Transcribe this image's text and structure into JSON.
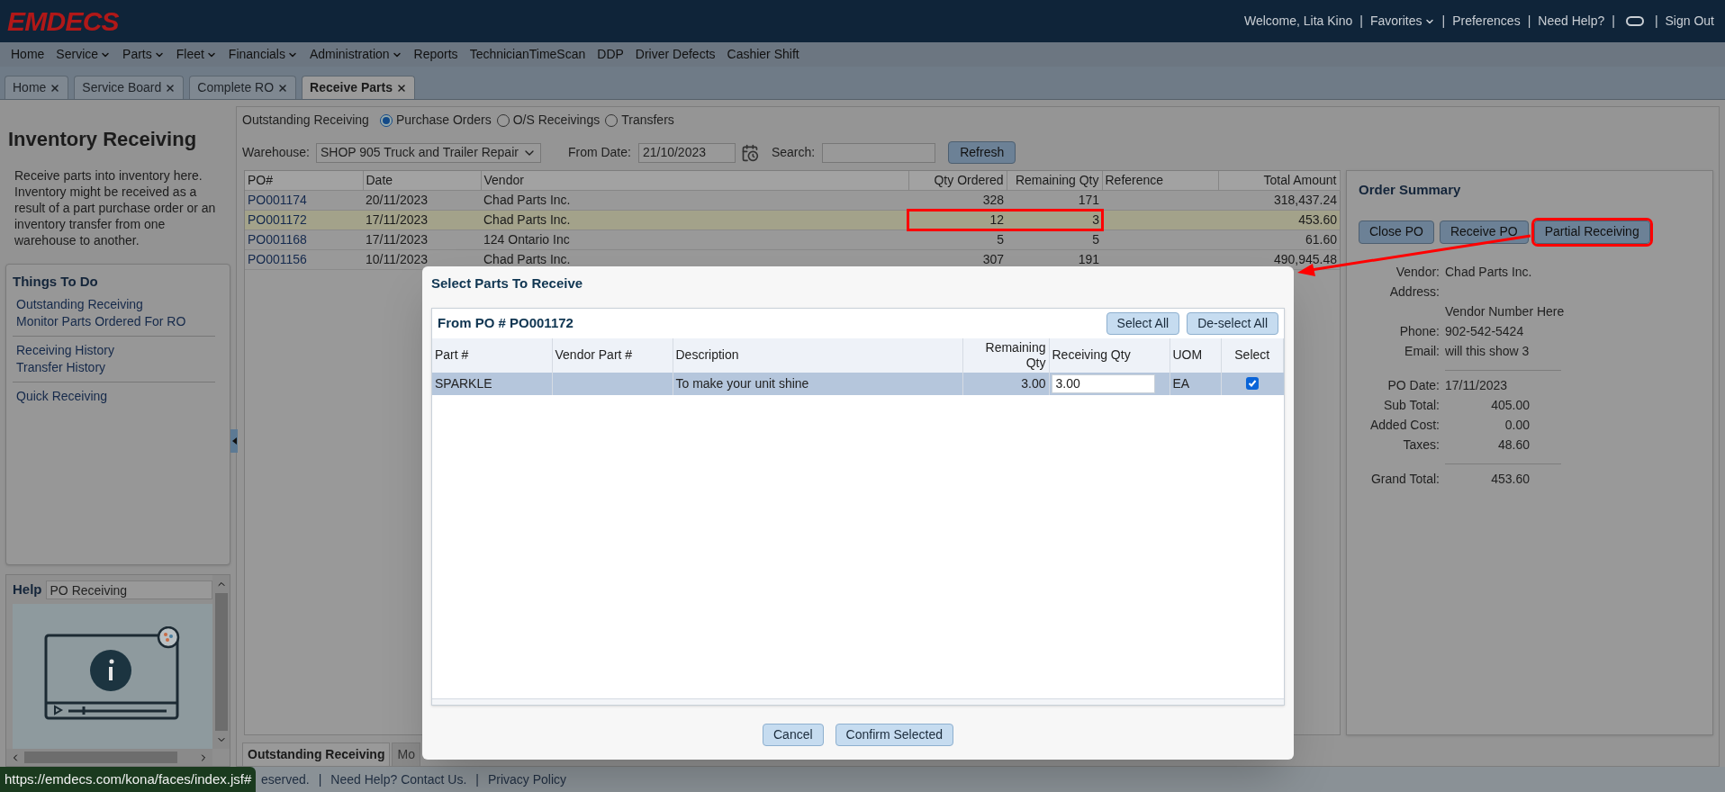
{
  "header": {
    "logo": "EMDECS",
    "items": [
      {
        "kind": "text",
        "label": "Welcome, Lita Kino"
      },
      {
        "kind": "separator",
        "label": "|"
      },
      {
        "kind": "menu",
        "label": "Favorites"
      },
      {
        "kind": "separator",
        "label": "|"
      },
      {
        "kind": "link",
        "label": "Preferences"
      },
      {
        "kind": "separator",
        "label": "|"
      },
      {
        "kind": "link",
        "label": "Need Help?"
      },
      {
        "kind": "separator",
        "label": "|"
      },
      {
        "kind": "toggle"
      },
      {
        "kind": "separator",
        "label": "|"
      },
      {
        "kind": "link",
        "label": "Sign Out"
      }
    ]
  },
  "menu": [
    {
      "label": "Home",
      "dropdown": false
    },
    {
      "label": "Service",
      "dropdown": true
    },
    {
      "label": "Parts",
      "dropdown": true
    },
    {
      "label": "Fleet",
      "dropdown": true
    },
    {
      "label": "Financials",
      "dropdown": true
    },
    {
      "label": "Administration",
      "dropdown": true
    },
    {
      "label": "Reports",
      "dropdown": false
    },
    {
      "label": "TechnicianTimeScan",
      "dropdown": false
    },
    {
      "label": "DDP",
      "dropdown": false
    },
    {
      "label": "Driver Defects",
      "dropdown": false
    },
    {
      "label": "Cashier Shift",
      "dropdown": false
    }
  ],
  "tabs": [
    {
      "label": "Home",
      "selected": false
    },
    {
      "label": "Service Board",
      "selected": false
    },
    {
      "label": "Complete RO",
      "selected": false
    },
    {
      "label": "Receive Parts",
      "selected": true
    }
  ],
  "sidebar": {
    "title": "Inventory Receiving",
    "description": "Receive parts into inventory here. Inventory might be received as a result of a part purchase order or an inventory transfer from one warehouse to another.",
    "todo": {
      "title": "Things To Do",
      "groups": [
        [
          "Outstanding Receiving",
          "Monitor Parts Ordered For RO"
        ],
        [
          "Receiving History",
          "Transfer History"
        ],
        [
          "Quick Receiving"
        ]
      ]
    },
    "help": {
      "label": "Help",
      "topic": "PO Receiving"
    }
  },
  "main": {
    "filter": {
      "label": "Outstanding Receiving",
      "options": [
        {
          "label": "Purchase Orders",
          "selected": true
        },
        {
          "label": "O/S Receivings",
          "selected": false
        },
        {
          "label": "Transfers",
          "selected": false
        }
      ]
    },
    "warehouse": {
      "label": "Warehouse:",
      "value": "SHOP 905 Truck and Trailer Repair"
    },
    "from_date": {
      "label": "From Date:",
      "value": "21/10/2023"
    },
    "search": {
      "label": "Search:"
    },
    "refresh": "Refresh",
    "table": {
      "columns": [
        "PO#",
        "Date",
        "Vendor",
        "Qty Ordered",
        "Remaining Qty",
        "Reference",
        "Total Amount"
      ],
      "rows": [
        {
          "po": "PO001174",
          "date": "20/11/2023",
          "vendor": "Chad Parts Inc.",
          "qty_ordered": "328",
          "remaining": "171",
          "total": "318,437.24",
          "selected": false,
          "annotated": false
        },
        {
          "po": "PO001172",
          "date": "17/11/2023",
          "vendor": "Chad Parts Inc.",
          "qty_ordered": "12",
          "remaining": "3",
          "total": "453.60",
          "selected": true,
          "annotated": true
        },
        {
          "po": "PO001168",
          "date": "17/11/2023",
          "vendor": "124 Ontario Inc",
          "qty_ordered": "5",
          "remaining": "5",
          "total": "61.60",
          "selected": false,
          "annotated": false
        },
        {
          "po": "PO001156",
          "date": "10/11/2023",
          "vendor": "Chad Parts Inc.",
          "qty_ordered": "307",
          "remaining": "191",
          "total": "490,945.48",
          "selected": false,
          "annotated": false
        }
      ]
    },
    "bottom_tabs": [
      {
        "label": "Outstanding Receiving",
        "selected": true
      },
      {
        "label": "Mo",
        "selected": false
      }
    ]
  },
  "order_summary": {
    "title": "Order Summary",
    "buttons": [
      {
        "label": "Close PO",
        "annotated": false
      },
      {
        "label": "Receive PO",
        "annotated": false
      },
      {
        "label": "Partial Receiving",
        "annotated": true
      }
    ],
    "groups": [
      [
        {
          "label": "Vendor:",
          "value": "Chad Parts Inc.",
          "kind": "text"
        },
        {
          "label": "Address:"
        },
        {
          "value": "Vendor Number Here",
          "kind": "text"
        },
        {
          "label": "Phone:",
          "value": "902-542-5424",
          "kind": "text"
        },
        {
          "label": "Email:",
          "value": "will this show 3",
          "kind": "text"
        }
      ],
      [
        {
          "label": "PO Date:",
          "value": "17/11/2023",
          "kind": "text"
        },
        {
          "label": "Sub Total:",
          "value": "405.00",
          "kind": "amount"
        },
        {
          "label": "Added Cost:",
          "value": "0.00",
          "kind": "amount"
        },
        {
          "label": "Taxes:",
          "value": "48.60",
          "kind": "amount"
        }
      ],
      [
        {
          "label": "Grand Total:",
          "value": "453.60",
          "kind": "amount"
        }
      ]
    ]
  },
  "footer": {
    "items": [
      "eserved.",
      "|",
      "Need Help? Contact Us.",
      "|",
      "Privacy Policy"
    ],
    "status_url": "https://emdecs.com/kona/faces/index.jsf#"
  },
  "modal": {
    "title": "Select Parts To Receive",
    "subtitle": "From PO # PO001172",
    "actions": [
      "Select All",
      "De-select All"
    ],
    "columns": [
      "Part #",
      "Vendor Part #",
      "Description",
      "Remaining Qty",
      "Receiving Qty",
      "UOM",
      "Select"
    ],
    "rows": [
      {
        "part": "SPARKLE",
        "description": "To make your unit shine",
        "remaining": "3.00",
        "receiving": "3.00",
        "uom": "EA",
        "checked": true
      }
    ],
    "buttons": [
      "Cancel",
      "Confirm Selected"
    ]
  }
}
